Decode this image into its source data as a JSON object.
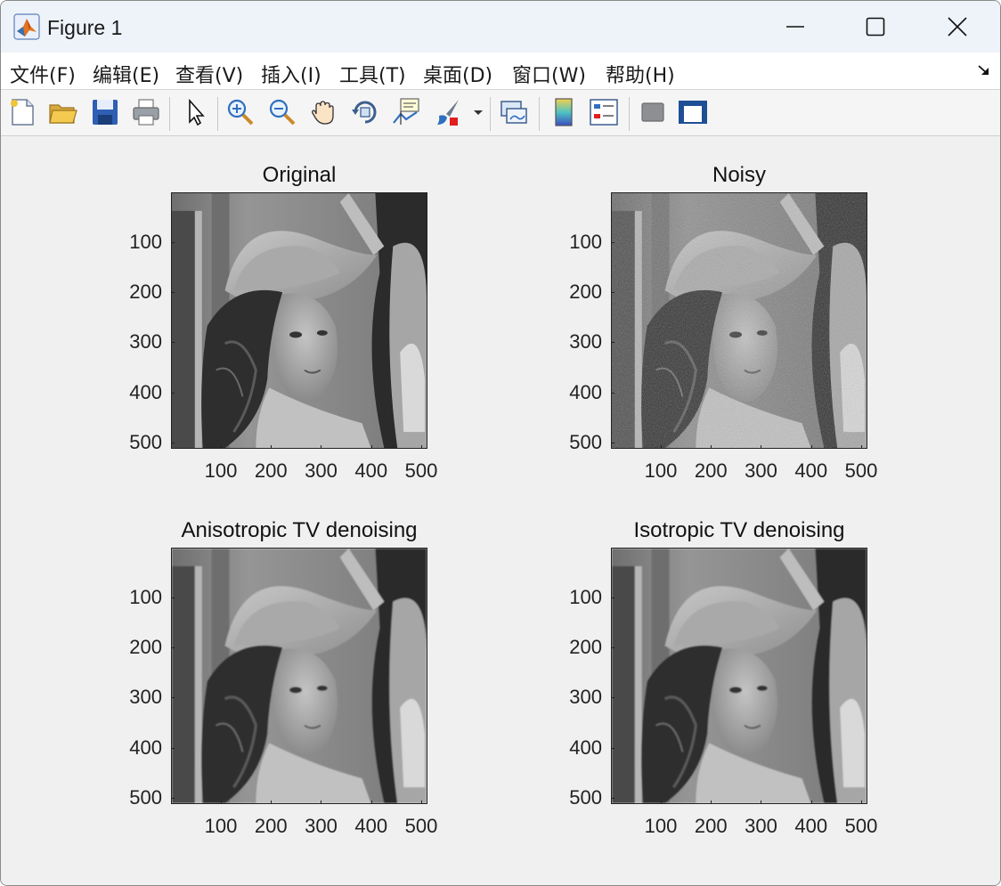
{
  "window": {
    "title": "Figure 1"
  },
  "menu": [
    "文件(F)",
    "编辑(E)",
    "查看(V)",
    "插入(I)",
    "工具(T)",
    "桌面(D)",
    "窗口(W)",
    "帮助(H)"
  ],
  "toolbar": [
    "new-figure-icon",
    "open-file-icon",
    "save-icon",
    "print-icon",
    "select-arrow-icon",
    "zoom-in-icon",
    "zoom-out-icon",
    "pan-hand-icon",
    "rotate-3d-icon",
    "data-cursor-icon",
    "brush-icon",
    "brush-dropdown-icon",
    "link-plot-icon",
    "colorbar-icon",
    "legend-icon",
    "hide-plot-tools-icon",
    "show-plot-tools-icon"
  ],
  "plots": [
    {
      "title": "Original",
      "variant": "original"
    },
    {
      "title": "Noisy",
      "variant": "noisy"
    },
    {
      "title": "Anisotropic TV denoising",
      "variant": "aniso"
    },
    {
      "title": "Isotropic TV denoising",
      "variant": "iso"
    }
  ],
  "axes": {
    "yticks": [
      "100",
      "200",
      "300",
      "400",
      "500"
    ],
    "xticks": [
      "100",
      "200",
      "300",
      "400",
      "500"
    ],
    "range": [
      0.5,
      512.5
    ]
  }
}
